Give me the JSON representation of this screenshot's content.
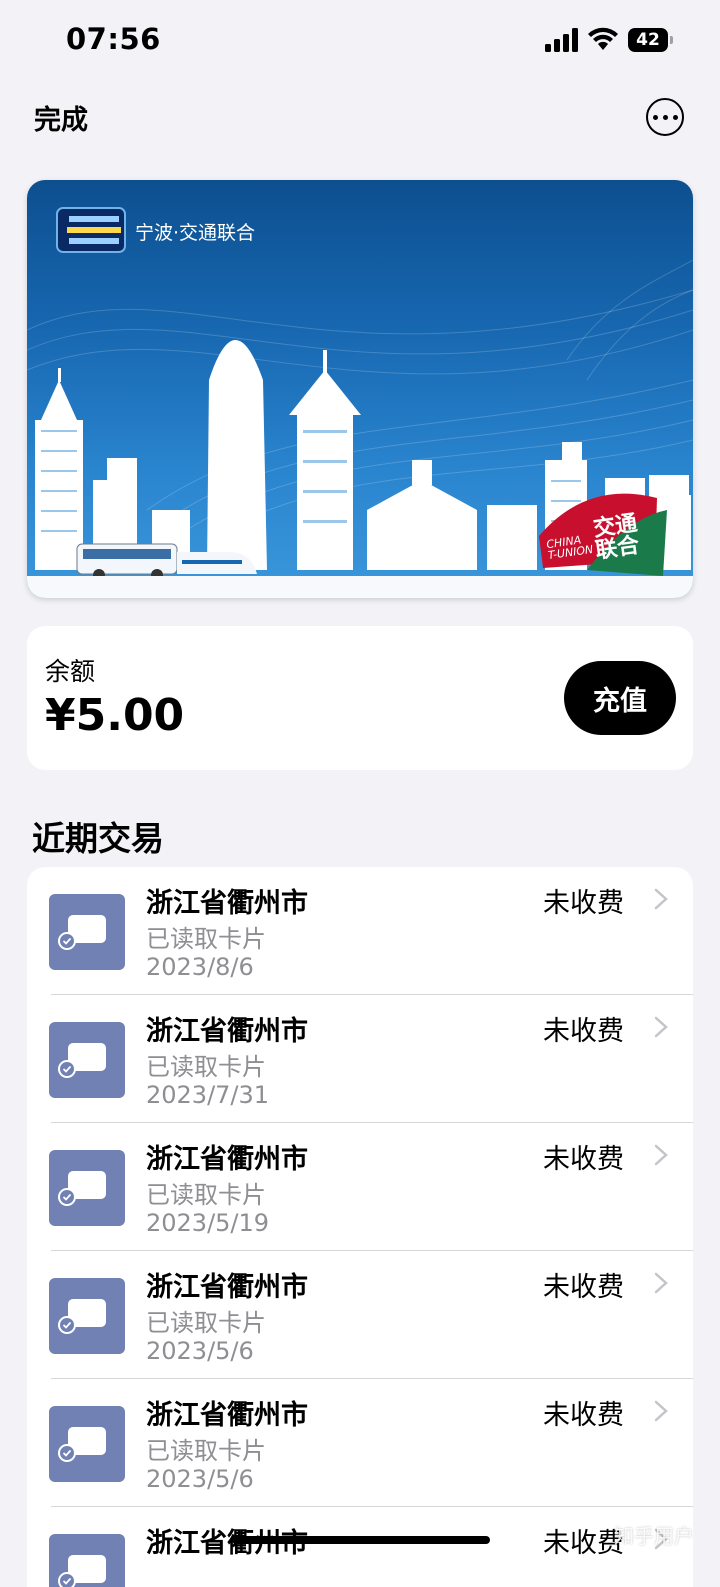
{
  "status_bar": {
    "time": "07:56",
    "battery": "42",
    "icons": [
      "cellular-signal-icon",
      "wifi-icon",
      "battery-icon"
    ]
  },
  "nav": {
    "done_label": "完成",
    "more_icon": "ellipsis-circle-icon"
  },
  "card": {
    "issuer": "宁波·交通联合",
    "brand_logo": "ningbo-transport-logo",
    "union_text_top": "交通",
    "union_text_bottom": "联合",
    "union_small_top": "CHINA",
    "union_small_bottom": "T-UNION",
    "colors": {
      "bg_dark": "#0d4f8f",
      "bg_light": "#3c98dc",
      "union_red": "#c8102e",
      "union_green": "#1a7a4a"
    }
  },
  "balance": {
    "label": "余额",
    "value": "¥5.00",
    "topup_label": "充值"
  },
  "transactions": {
    "header": "近期交易",
    "items": [
      {
        "location": "浙江省衢州市",
        "detail": "已读取卡片",
        "date": "2023/8/6",
        "status": "未收费"
      },
      {
        "location": "浙江省衢州市",
        "detail": "已读取卡片",
        "date": "2023/7/31",
        "status": "未收费"
      },
      {
        "location": "浙江省衢州市",
        "detail": "已读取卡片",
        "date": "2023/5/19",
        "status": "未收费"
      },
      {
        "location": "浙江省衢州市",
        "detail": "已读取卡片",
        "date": "2023/5/6",
        "status": "未收费"
      },
      {
        "location": "浙江省衢州市",
        "detail": "已读取卡片",
        "date": "2023/5/6",
        "status": "未收费"
      },
      {
        "location": "浙江省衢州市",
        "detail": "",
        "date": "",
        "status": "未收费"
      }
    ]
  },
  "watermark": "知乎用户"
}
